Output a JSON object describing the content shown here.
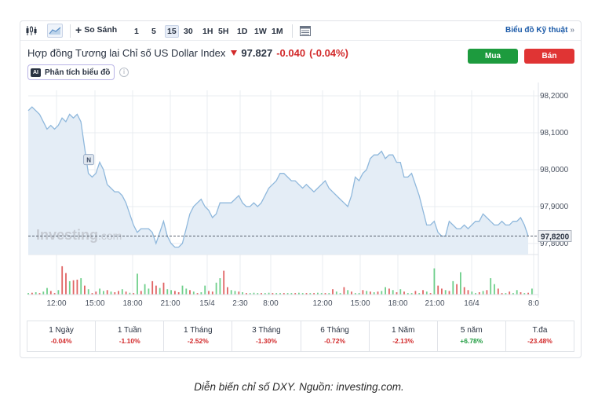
{
  "toolbar": {
    "compare_label": "So Sánh",
    "timeframes": [
      "1",
      "5",
      "15",
      "30",
      "1H",
      "5H",
      "1D",
      "1W",
      "1M"
    ],
    "active_timeframe": "15",
    "technical_label": "Biểu đồ Kỹ thuật",
    "technical_suffix": "»"
  },
  "header": {
    "instrument": "Hợp đồng Tương lai Chỉ số US Dollar Index",
    "price": "97.827",
    "change": "-0.040",
    "change_pct": "(-0.04%)",
    "buy_label": "Mua",
    "sell_label": "Bán",
    "ai_badge": "AI",
    "ai_label": "Phân tích biểu đồ",
    "info_icon": "i"
  },
  "chart_data": {
    "type": "area",
    "watermark": "Investing",
    "watermark_suffix": ".com",
    "event_marker": "N",
    "current_price_label": "97,8200",
    "y_ticks": [
      "98,2000",
      "98,1000",
      "98,0000",
      "97,9000",
      "97,8000"
    ],
    "y_tick_values": [
      98.2,
      98.1,
      98.0,
      97.9,
      97.8
    ],
    "ylim": [
      97.77,
      98.215
    ],
    "current_value": 97.82,
    "x_tick_labels": [
      "12:00",
      "15:00",
      "18:00",
      "21:00",
      "15/4",
      "2:30",
      "8:00",
      "12:00",
      "15:00",
      "18:00",
      "21:00",
      "16/4",
      "8:0"
    ],
    "colors": {
      "line": "#8fb8dc",
      "fill": "#e4edf6",
      "up": "#6fcf8b",
      "down": "#e06464",
      "grid": "#e9ecf0"
    },
    "series": [
      {
        "values": [
          98.16,
          98.17,
          98.16,
          98.15,
          98.13,
          98.11,
          98.12,
          98.11,
          98.12,
          98.14,
          98.13,
          98.15,
          98.14,
          98.15,
          98.13,
          98.06,
          97.99,
          97.98,
          97.99,
          98.02,
          98.0,
          97.96,
          97.95,
          97.94,
          97.94,
          97.93,
          97.91,
          97.88,
          97.85,
          97.83,
          97.84,
          97.84,
          97.84,
          97.83,
          97.8,
          97.83,
          97.86,
          97.82,
          97.8,
          97.79,
          97.79,
          97.8,
          97.84,
          97.88,
          97.9,
          97.91,
          97.92,
          97.9,
          97.89,
          97.87,
          97.88,
          97.91,
          97.91,
          97.91,
          97.91,
          97.92,
          97.93,
          97.91,
          97.9,
          97.9,
          97.91,
          97.9,
          97.91,
          97.93,
          97.95,
          97.96,
          97.97,
          97.99,
          97.99,
          97.98,
          97.97,
          97.97,
          97.96,
          97.95,
          97.96,
          97.95,
          97.94,
          97.95,
          97.96,
          97.97,
          97.95,
          97.94,
          97.93,
          97.92,
          97.91,
          97.9,
          97.93,
          97.98,
          97.97,
          97.99,
          98.0,
          98.03,
          98.04,
          98.04,
          98.05,
          98.03,
          98.04,
          98.04,
          98.02,
          98.02,
          97.98,
          97.98,
          97.99,
          97.96,
          97.93,
          97.89,
          97.85,
          97.85,
          97.86,
          97.83,
          97.82,
          97.82,
          97.86,
          97.85,
          97.84,
          97.84,
          97.85,
          97.84,
          97.85,
          97.86,
          97.86,
          97.88,
          97.87,
          97.86,
          97.85,
          97.85,
          97.86,
          97.85,
          97.85,
          97.86,
          97.86,
          97.87,
          97.85,
          97.82
        ]
      }
    ],
    "volumes": [
      0.05,
      0.06,
      0.08,
      0.05,
      0.1,
      0.22,
      0.12,
      0.05,
      0.15,
      0.95,
      0.72,
      0.45,
      0.48,
      0.5,
      0.55,
      0.3,
      0.18,
      0.05,
      0.1,
      0.2,
      0.12,
      0.15,
      0.1,
      0.08,
      0.12,
      0.18,
      0.1,
      0.06,
      0.05,
      0.7,
      0.12,
      0.35,
      0.2,
      0.45,
      0.3,
      0.22,
      0.4,
      0.18,
      0.15,
      0.12,
      0.08,
      0.3,
      0.2,
      0.15,
      0.1,
      0.05,
      0.08,
      0.3,
      0.12,
      0.1,
      0.4,
      0.55,
      0.8,
      0.25,
      0.15,
      0.12,
      0.1,
      0.08,
      0.05,
      0.05,
      0.06,
      0.05,
      0.05,
      0.05,
      0.06,
      0.05,
      0.05,
      0.05,
      0.05,
      0.05,
      0.05,
      0.05,
      0.06,
      0.05,
      0.05,
      0.05,
      0.05,
      0.06,
      0.05,
      0.05,
      0.05,
      0.18,
      0.1,
      0.05,
      0.25,
      0.15,
      0.1,
      0.05,
      0.05,
      0.15,
      0.12,
      0.1,
      0.08,
      0.1,
      0.12,
      0.25,
      0.2,
      0.15,
      0.08,
      0.18,
      0.1,
      0.05,
      0.05,
      0.12,
      0.05,
      0.15,
      0.1,
      0.05,
      0.88,
      0.3,
      0.2,
      0.15,
      0.12,
      0.45,
      0.35,
      0.75,
      0.25,
      0.15,
      0.1,
      0.05,
      0.08,
      0.12,
      0.15,
      0.55,
      0.35,
      0.2,
      0.05,
      0.05,
      0.1,
      0.05,
      0.15,
      0.08,
      0.05,
      0.06,
      0.2
    ],
    "volume_dirs": [
      0,
      1,
      0,
      1,
      0,
      0,
      1,
      1,
      0,
      1,
      1,
      0,
      1,
      1,
      0,
      1,
      0,
      1,
      1,
      0,
      0,
      1,
      0,
      1,
      1,
      0,
      1,
      0,
      1,
      0,
      1,
      0,
      0,
      1,
      1,
      0,
      1,
      0,
      0,
      1,
      1,
      0,
      0,
      1,
      0,
      1,
      0,
      0,
      1,
      1,
      0,
      0,
      1,
      1,
      0,
      0,
      1,
      0,
      1,
      0,
      0,
      0,
      1,
      0,
      0,
      1,
      0,
      0,
      1,
      0,
      0,
      1,
      0,
      0,
      1,
      0,
      1,
      0,
      0,
      1,
      0,
      1,
      0,
      0,
      1,
      0,
      1,
      0,
      0,
      1,
      0,
      1,
      0,
      1,
      0,
      0,
      1,
      0,
      1,
      0,
      1,
      0,
      0,
      1,
      0,
      1,
      0,
      1,
      0,
      1,
      1,
      0,
      1,
      0,
      1,
      0,
      1,
      1,
      0,
      0,
      1,
      0,
      1,
      0,
      0,
      1,
      1,
      0,
      1,
      0,
      0,
      1,
      0,
      1,
      0
    ]
  },
  "periods": [
    {
      "label": "1 Ngày",
      "value": "-0.04%",
      "dir": "neg"
    },
    {
      "label": "1 Tuần",
      "value": "-1.10%",
      "dir": "neg"
    },
    {
      "label": "1 Tháng",
      "value": "-2.52%",
      "dir": "neg"
    },
    {
      "label": "3 Tháng",
      "value": "-1.30%",
      "dir": "neg"
    },
    {
      "label": "6 Tháng",
      "value": "-0.72%",
      "dir": "neg"
    },
    {
      "label": "1 Năm",
      "value": "-2.13%",
      "dir": "neg"
    },
    {
      "label": "5 năm",
      "value": "+6.78%",
      "dir": "pos"
    },
    {
      "label": "T.đa",
      "value": "-23.48%",
      "dir": "neg"
    }
  ],
  "caption": "Diễn biến chỉ số DXY. Nguồn: investing.com."
}
